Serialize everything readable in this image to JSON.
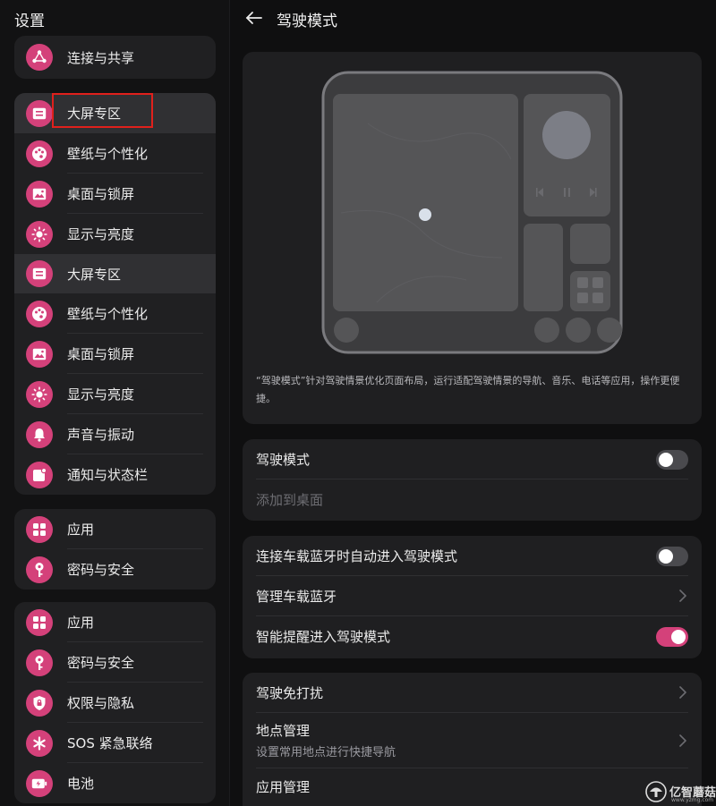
{
  "left": {
    "title": "设置",
    "groups": [
      {
        "items": [
          {
            "label": "连接与共享",
            "icon": "share-icon"
          }
        ]
      },
      {
        "items": [
          {
            "label": "大屏专区",
            "icon": "large-screen-icon",
            "selected": true
          },
          {
            "label": "壁纸与个性化",
            "icon": "palette-icon"
          },
          {
            "label": "桌面与锁屏",
            "icon": "image-icon"
          },
          {
            "label": "显示与亮度",
            "icon": "sun-icon"
          },
          {
            "label": "大屏专区",
            "icon": "large-screen-icon",
            "selected": true
          },
          {
            "label": "壁纸与个性化",
            "icon": "palette-icon"
          },
          {
            "label": "桌面与锁屏",
            "icon": "image-icon"
          },
          {
            "label": "显示与亮度",
            "icon": "sun-icon"
          },
          {
            "label": "声音与振动",
            "icon": "bell-icon"
          },
          {
            "label": "通知与状态栏",
            "icon": "notification-icon"
          }
        ]
      },
      {
        "items": [
          {
            "label": "应用",
            "icon": "apps-icon"
          },
          {
            "label": "密码与安全",
            "icon": "key-icon"
          }
        ]
      },
      {
        "items": [
          {
            "label": "应用",
            "icon": "apps-icon"
          },
          {
            "label": "密码与安全",
            "icon": "key-icon"
          },
          {
            "label": "权限与隐私",
            "icon": "shield-icon"
          },
          {
            "label": "SOS 紧急联络",
            "icon": "sos-icon"
          },
          {
            "label": "电池",
            "icon": "battery-icon"
          }
        ]
      }
    ]
  },
  "right": {
    "title": "驾驶模式",
    "preview_description": "“驾驶模式”针对驾驶情景优化页面布局，运行适配驾驶情景的导航、音乐、电话等应用，操作更便捷。",
    "settings": {
      "driving_mode": {
        "label": "驾驶模式",
        "enabled": false
      },
      "add_to_desktop": {
        "label": "添加到桌面"
      },
      "auto_bt": {
        "label": "连接车载蓝牙时自动进入驾驶模式",
        "enabled": false
      },
      "manage_bt": {
        "label": "管理车载蓝牙"
      },
      "smart_prompt": {
        "label": "智能提醒进入驾驶模式",
        "enabled": true
      },
      "dnd": {
        "label": "驾驶免打扰"
      },
      "places": {
        "label": "地点管理",
        "sub": "设置常用地点进行快捷导航"
      },
      "apps": {
        "label": "应用管理"
      }
    }
  },
  "watermark": {
    "text": "亿智蘑菇",
    "url": "www.yzmg.com"
  },
  "colors": {
    "accent": "#d4417a",
    "highlight_box": "#e0201c",
    "background": "#0f0f10",
    "card": "#1f1f21"
  }
}
